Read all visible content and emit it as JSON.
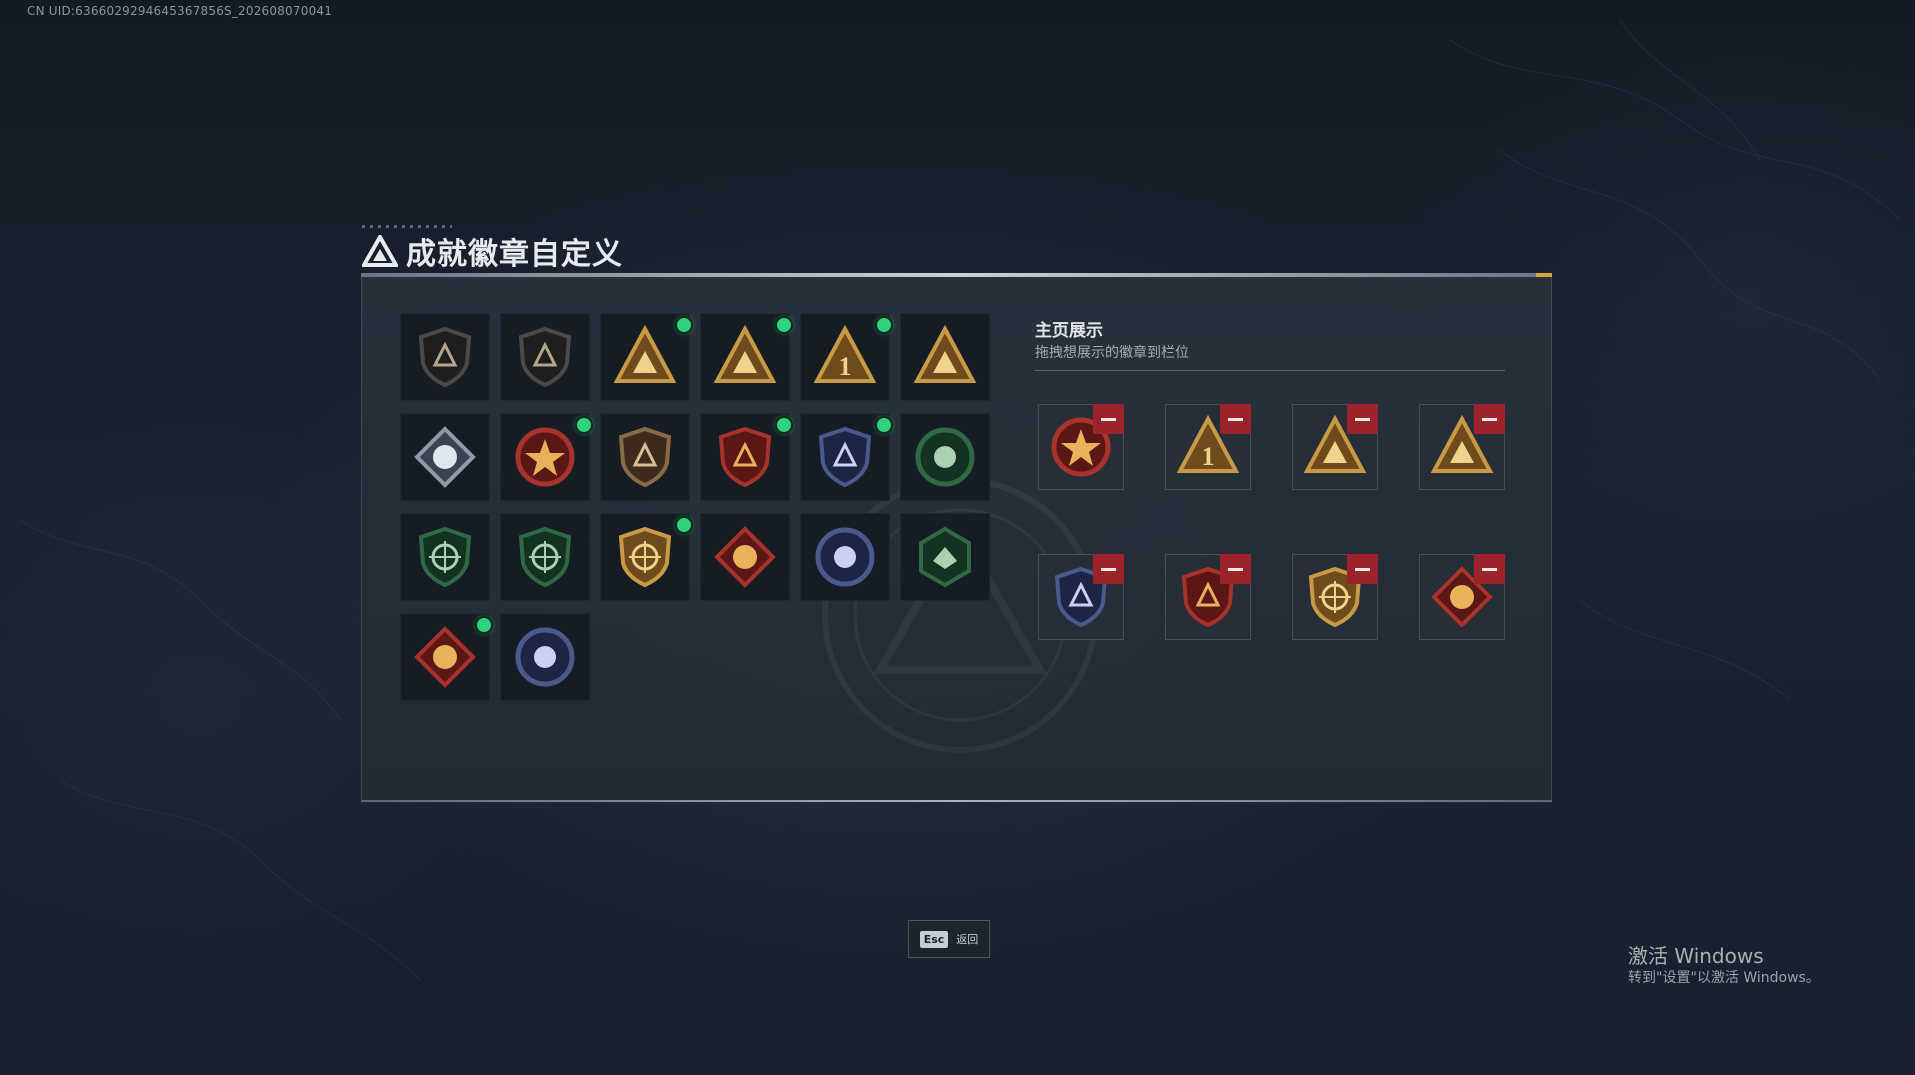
{
  "uid_text": "CN UID:6366029294645367856S_202608070041",
  "header": {
    "title": "成就徽章自定义",
    "icon": "triangle-logo-icon"
  },
  "colors": {
    "new_indicator": "#2fd27d",
    "remove": "#9c2329",
    "accent": "#d7a443"
  },
  "badge_library": [
    {
      "name": "shield-triangle-badge",
      "is_new": false
    },
    {
      "name": "helicopter-badge",
      "is_new": false
    },
    {
      "name": "gold-triangle-crate-badge",
      "is_new": true
    },
    {
      "name": "gold-triangle-helmet-badge",
      "is_new": true
    },
    {
      "name": "gold-triangle-number-one-badge",
      "is_new": true
    },
    {
      "name": "gold-triangle-soldiers-badge",
      "is_new": false
    },
    {
      "name": "silver-diamond-skull-badge",
      "is_new": false
    },
    {
      "name": "red-star-medal-badge",
      "is_new": true
    },
    {
      "name": "bronze-shield-badge",
      "is_new": false
    },
    {
      "name": "red-stars-shield-badge",
      "is_new": true
    },
    {
      "name": "blue-stars-shield-badge",
      "is_new": true
    },
    {
      "name": "green-skull-badge",
      "is_new": false
    },
    {
      "name": "green-crosshair-rifle-badge",
      "is_new": false
    },
    {
      "name": "green-crosshair-rifle-badge-2",
      "is_new": false
    },
    {
      "name": "gold-crosshair-shield-badge",
      "is_new": true
    },
    {
      "name": "red-diamond-wolf-badge",
      "is_new": false
    },
    {
      "name": "blue-round-eagle-badge",
      "is_new": false
    },
    {
      "name": "green-hexagon-bird-badge",
      "is_new": false
    },
    {
      "name": "red-diamond-dragon-badge",
      "is_new": true
    },
    {
      "name": "blue-round-wolf-badge",
      "is_new": false
    }
  ],
  "showcase": {
    "title": "主页展示",
    "subtitle": "拖拽想展示的徽章到栏位",
    "slots": [
      {
        "name": "red-star-medal-badge"
      },
      {
        "name": "gold-triangle-number-one-badge"
      },
      {
        "name": "gold-triangle-helmet-badge"
      },
      {
        "name": "gold-triangle-crate-badge"
      },
      {
        "name": "blue-stars-shield-badge"
      },
      {
        "name": "red-stars-shield-badge"
      },
      {
        "name": "gold-crosshair-shield-badge"
      },
      {
        "name": "red-diamond-dragon-badge"
      }
    ]
  },
  "footer": {
    "esc_key": "Esc",
    "esc_label": "返回"
  },
  "windows_watermark": {
    "title": "激活 Windows",
    "subtitle": "转到\"设置\"以激活 Windows。"
  }
}
